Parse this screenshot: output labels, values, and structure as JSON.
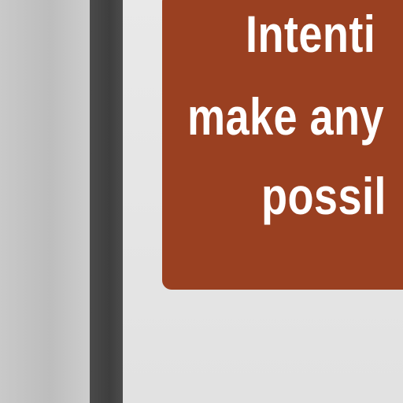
{
  "sign": {
    "lines": [
      "Intenti",
      "make any",
      "possil"
    ]
  },
  "colors": {
    "sign_background": "#9a4021",
    "sign_text": "#ffffff",
    "left_panel": "#c4c4c4",
    "divider_bar": "#444444",
    "background": "#e4e4e4"
  }
}
